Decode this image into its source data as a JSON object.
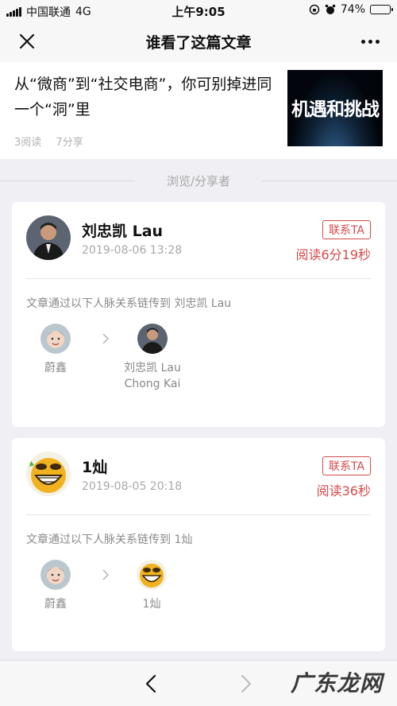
{
  "status_bar": {
    "carrier": "中国联通",
    "network": "4G",
    "time": "上午9:05",
    "battery": "74%",
    "battery_level": 0.74
  },
  "nav": {
    "title": "谁看了这篇文章"
  },
  "article": {
    "title": "从“微商”到“社交电商”，你可别掉进同一个“洞”里",
    "reads": "3阅读",
    "age": "7分享",
    "thumb_text": "机遇和挑战"
  },
  "section_label": "浏览/分享者",
  "visitors": [
    {
      "name": "刘忠凯 Lau",
      "time": "2019-08-06 13:28",
      "contact_label": "联系TA",
      "read_time": "阅读6分19秒",
      "chain_text": "文章通过以下人脉关系链传到 刘忠凯 Lau",
      "chain": [
        {
          "name": "蔚鑫"
        },
        {
          "name": "刘忠凯 Lau",
          "name2": "Chong Kai"
        }
      ]
    },
    {
      "name": "1灿",
      "time": "2019-08-05 20:18",
      "contact_label": "联系TA",
      "read_time": "阅读36秒",
      "chain_text": "文章通过以下人脉关系链传到 1灿",
      "chain": [
        {
          "name": "蔚鑫"
        },
        {
          "name": "1灿"
        }
      ]
    }
  ],
  "watermark": "广东龙网",
  "colors": {
    "accent": "#d34a4a",
    "background": "#efeff4"
  }
}
